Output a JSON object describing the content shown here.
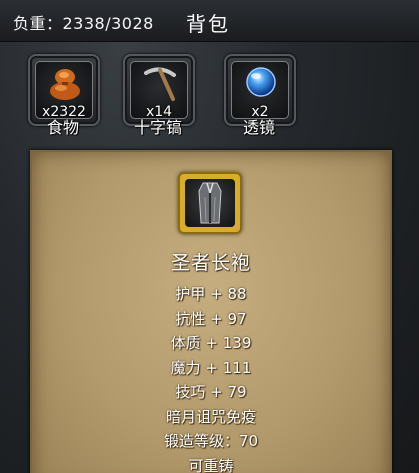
{
  "header": {
    "load_label": "负重：2338/3028",
    "title": "背包"
  },
  "items": [
    {
      "icon": "food-icon",
      "count": "x2322",
      "name": "食物"
    },
    {
      "icon": "pickaxe-icon",
      "count": "x14",
      "name": "十字镐"
    },
    {
      "icon": "lens-icon",
      "count": "x2",
      "name": "透镜"
    }
  ],
  "detail": {
    "icon": "robe-icon",
    "name": "圣者长袍",
    "stats": [
      "护甲 + 88",
      "抗性 + 97",
      "体质 + 139",
      "魔力 + 111",
      "技巧 + 79",
      "暗月诅咒免疫",
      "锻造等级：70",
      "可重铸"
    ]
  },
  "colors": {
    "parchment": "#b39a6c",
    "selected_border": "#d9ad2c"
  }
}
